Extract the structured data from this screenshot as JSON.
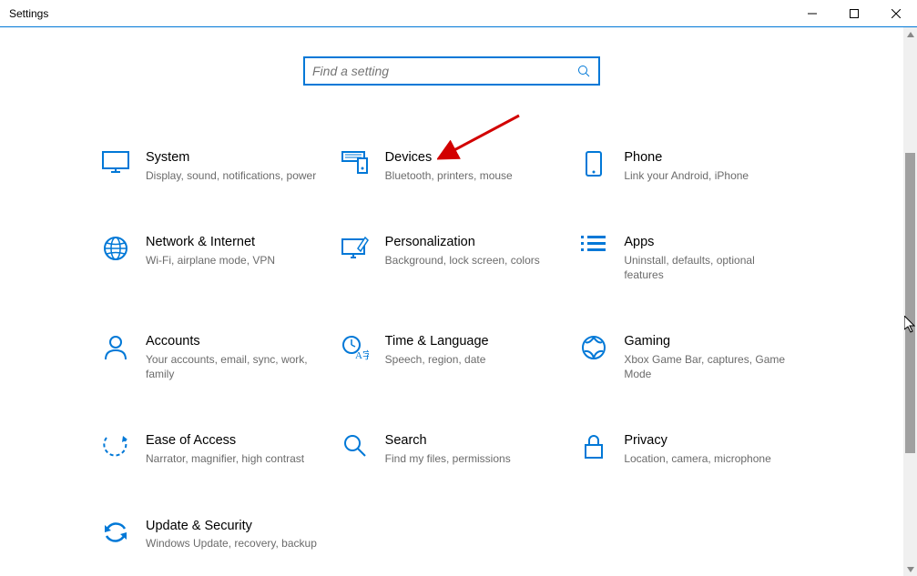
{
  "window": {
    "title": "Settings"
  },
  "search": {
    "placeholder": "Find a setting"
  },
  "tiles": {
    "system": {
      "title": "System",
      "sub": "Display, sound, notifications, power"
    },
    "devices": {
      "title": "Devices",
      "sub": "Bluetooth, printers, mouse"
    },
    "phone": {
      "title": "Phone",
      "sub": "Link your Android, iPhone"
    },
    "network": {
      "title": "Network & Internet",
      "sub": "Wi-Fi, airplane mode, VPN"
    },
    "personalization": {
      "title": "Personalization",
      "sub": "Background, lock screen, colors"
    },
    "apps": {
      "title": "Apps",
      "sub": "Uninstall, defaults, optional features"
    },
    "accounts": {
      "title": "Accounts",
      "sub": "Your accounts, email, sync, work, family"
    },
    "time": {
      "title": "Time & Language",
      "sub": "Speech, region, date"
    },
    "gaming": {
      "title": "Gaming",
      "sub": "Xbox Game Bar, captures, Game Mode"
    },
    "ease": {
      "title": "Ease of Access",
      "sub": "Narrator, magnifier, high contrast"
    },
    "searchcat": {
      "title": "Search",
      "sub": "Find my files, permissions"
    },
    "privacy": {
      "title": "Privacy",
      "sub": "Location, camera, microphone"
    },
    "update": {
      "title": "Update & Security",
      "sub": "Windows Update, recovery, backup"
    }
  },
  "colors": {
    "accent": "#0078d7"
  }
}
